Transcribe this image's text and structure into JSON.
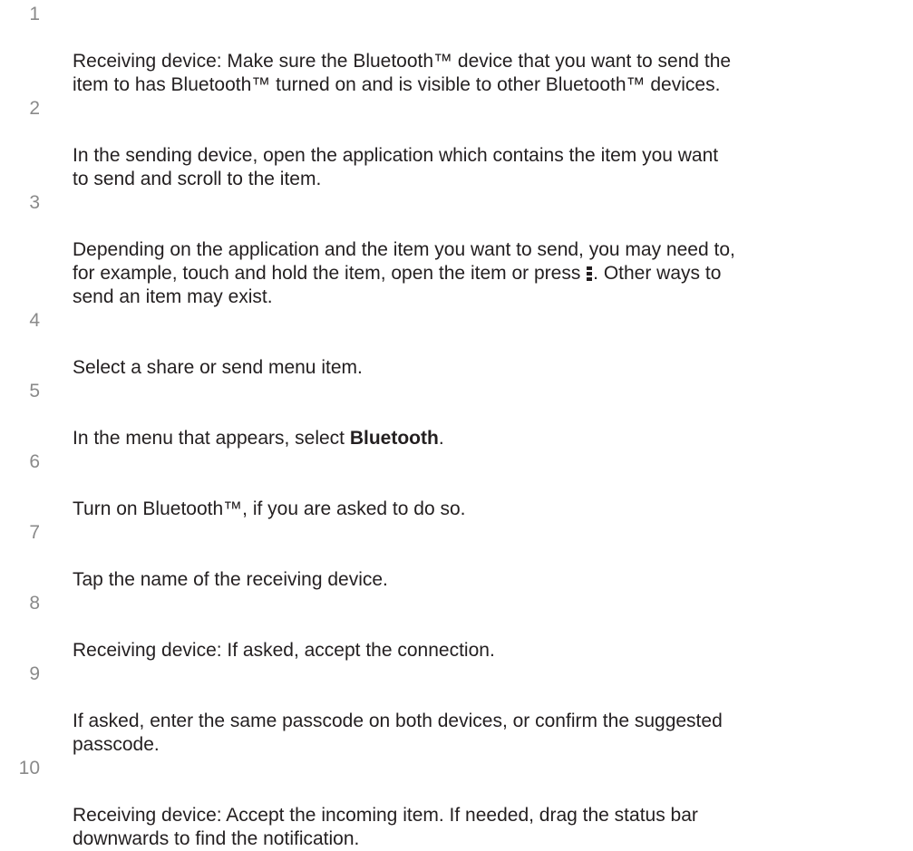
{
  "steps": [
    {
      "num": "1",
      "text": "Receiving device: Make sure the Bluetooth™ device that you want to send the\nitem to has Bluetooth™ turned on and is visible to other Bluetooth™ devices."
    },
    {
      "num": "2",
      "text": "In the sending device, open the application which contains the item you want\nto send and scroll to the item."
    },
    {
      "num": "3",
      "text_a": "Depending on the application and the item you want to send, you may need to,\nfor example, touch and hold the item, open the item or press ",
      "icon": "menu-dots-icon",
      "text_b": ". Other ways to\nsend an item may exist."
    },
    {
      "num": "4",
      "text": "Select a share or send menu item."
    },
    {
      "num": "5",
      "text_a": "In the menu that appears, select ",
      "bold": "Bluetooth",
      "text_b": "."
    },
    {
      "num": "6",
      "text": "Turn on Bluetooth™, if you are asked to do so."
    },
    {
      "num": "7",
      "text": "Tap the name of the receiving device."
    },
    {
      "num": "8",
      "text": "Receiving device: If asked, accept the connection."
    },
    {
      "num": "9",
      "text": "If asked, enter the same passcode on both devices, or confirm the suggested\npasscode."
    },
    {
      "num": "10",
      "text": "Receiving device: Accept the incoming item. If needed, drag the status bar\ndownwards to find the notification."
    }
  ]
}
